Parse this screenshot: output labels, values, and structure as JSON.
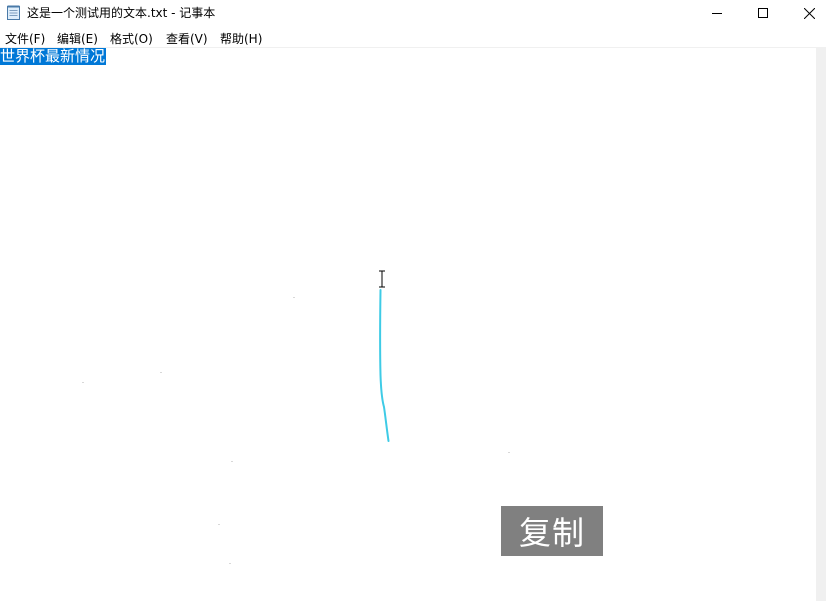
{
  "window": {
    "title": "这是一个测试用的文本.txt - 记事本",
    "app_icon": "notepad-icon"
  },
  "window_controls": {
    "minimize_icon": "minimize-icon",
    "maximize_icon": "maximize-icon",
    "close_icon": "close-icon"
  },
  "menu": {
    "items": [
      {
        "label": "文件(F)"
      },
      {
        "label": "编辑(E)"
      },
      {
        "label": "格式(O)"
      },
      {
        "label": "查看(V)"
      },
      {
        "label": "帮助(H)"
      }
    ]
  },
  "editor": {
    "selected_text": "世界杯最新情况",
    "selection_color": "#0078d7",
    "cursor_icon": "text-cursor-icon"
  },
  "overlay": {
    "label": "复制",
    "background": "#808080"
  }
}
